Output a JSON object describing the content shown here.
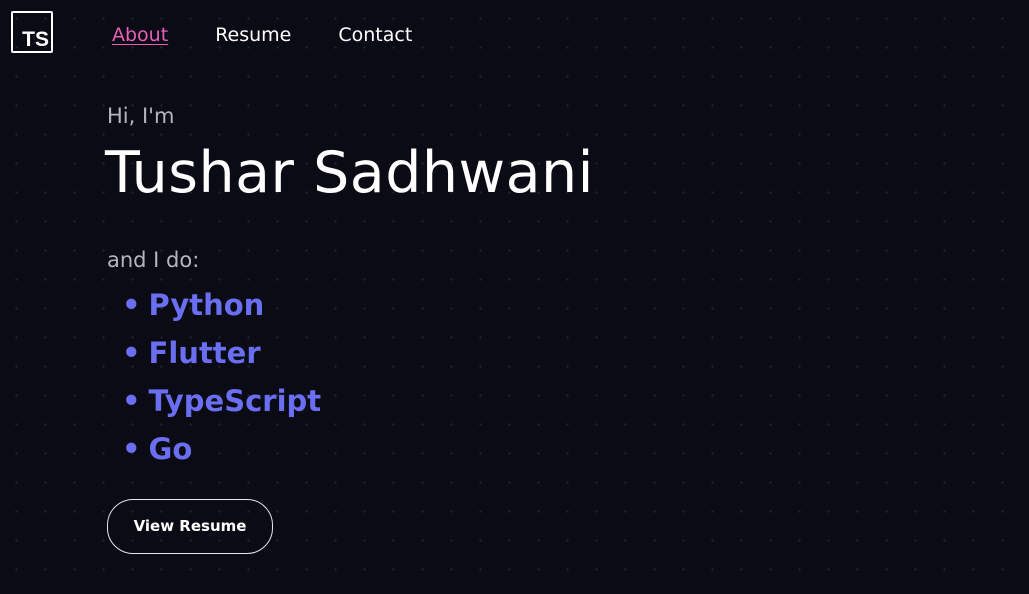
{
  "logo": {
    "text": "TS"
  },
  "nav": {
    "items": [
      {
        "label": "About",
        "active": true
      },
      {
        "label": "Resume",
        "active": false
      },
      {
        "label": "Contact",
        "active": false
      }
    ]
  },
  "hero": {
    "greeting": "Hi, I'm",
    "name": "Tushar Sadhwani",
    "intro": "and I do:",
    "bullet": "•",
    "skills": [
      "Python",
      "Flutter",
      "TypeScript",
      "Go"
    ],
    "button_label": "View Resume"
  },
  "colors": {
    "background": "#0b0b15",
    "accent_active_link": "#e85fb8",
    "skill_text": "#6a6ef0",
    "muted_text": "#b5b5c0"
  }
}
